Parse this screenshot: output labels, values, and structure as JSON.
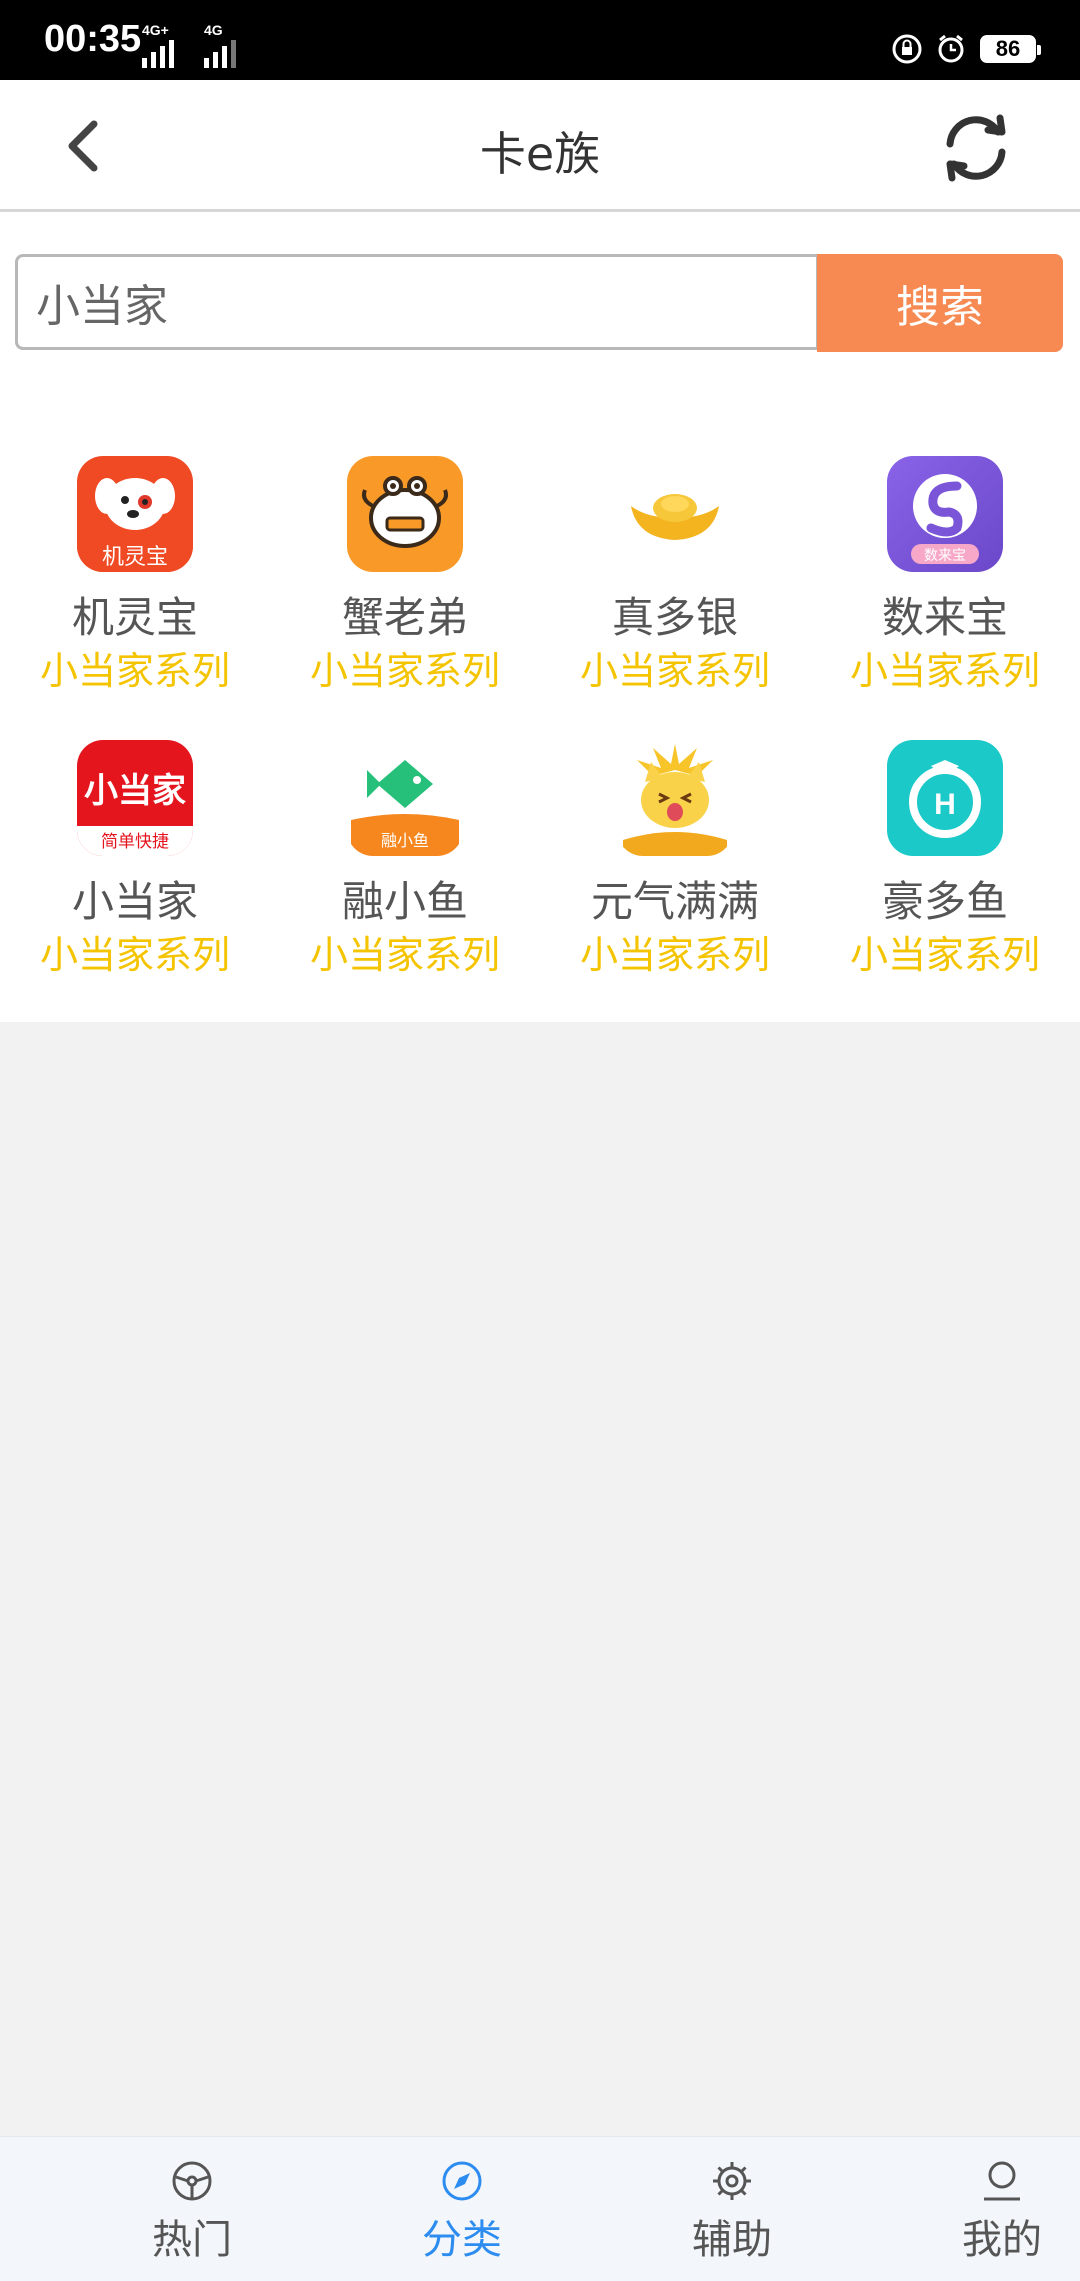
{
  "status_bar": {
    "time": "00:35",
    "sim1_label": "4G+",
    "sim2_label": "4G",
    "battery": "86"
  },
  "header": {
    "title": "卡e族"
  },
  "search": {
    "value": "小当家",
    "button_label": "搜索"
  },
  "apps": [
    {
      "name": "机灵宝",
      "series": "小当家系列",
      "icon_name": "jilingbao-icon",
      "icon_text": "机灵宝"
    },
    {
      "name": "蟹老弟",
      "series": "小当家系列",
      "icon_name": "xielaodi-icon"
    },
    {
      "name": "真多银",
      "series": "小当家系列",
      "icon_name": "zhenduoyin-icon"
    },
    {
      "name": "数来宝",
      "series": "小当家系列",
      "icon_name": "shulaibao-icon",
      "icon_text": "数来宝"
    },
    {
      "name": "小当家",
      "series": "小当家系列",
      "icon_name": "xiaodangjia-icon",
      "icon_text": "小当家",
      "icon_subtext": "简单快捷"
    },
    {
      "name": "融小鱼",
      "series": "小当家系列",
      "icon_name": "rongxiaoyu-icon",
      "icon_text": "融小鱼"
    },
    {
      "name": "元气满满",
      "series": "小当家系列",
      "icon_name": "yuanqimanman-icon"
    },
    {
      "name": "豪多鱼",
      "series": "小当家系列",
      "icon_name": "haoduoyu-icon",
      "icon_text": "H"
    }
  ],
  "bottom_nav": [
    {
      "label": "热门",
      "icon": "steering-wheel-icon",
      "active": false
    },
    {
      "label": "分类",
      "icon": "compass-icon",
      "active": true
    },
    {
      "label": "辅助",
      "icon": "gear-icon",
      "active": false
    },
    {
      "label": "我的",
      "icon": "person-icon",
      "active": false
    }
  ],
  "colors": {
    "accent_orange": "#f68a52",
    "series_yellow": "#f5c400",
    "nav_active_blue": "#2d8cf0"
  }
}
